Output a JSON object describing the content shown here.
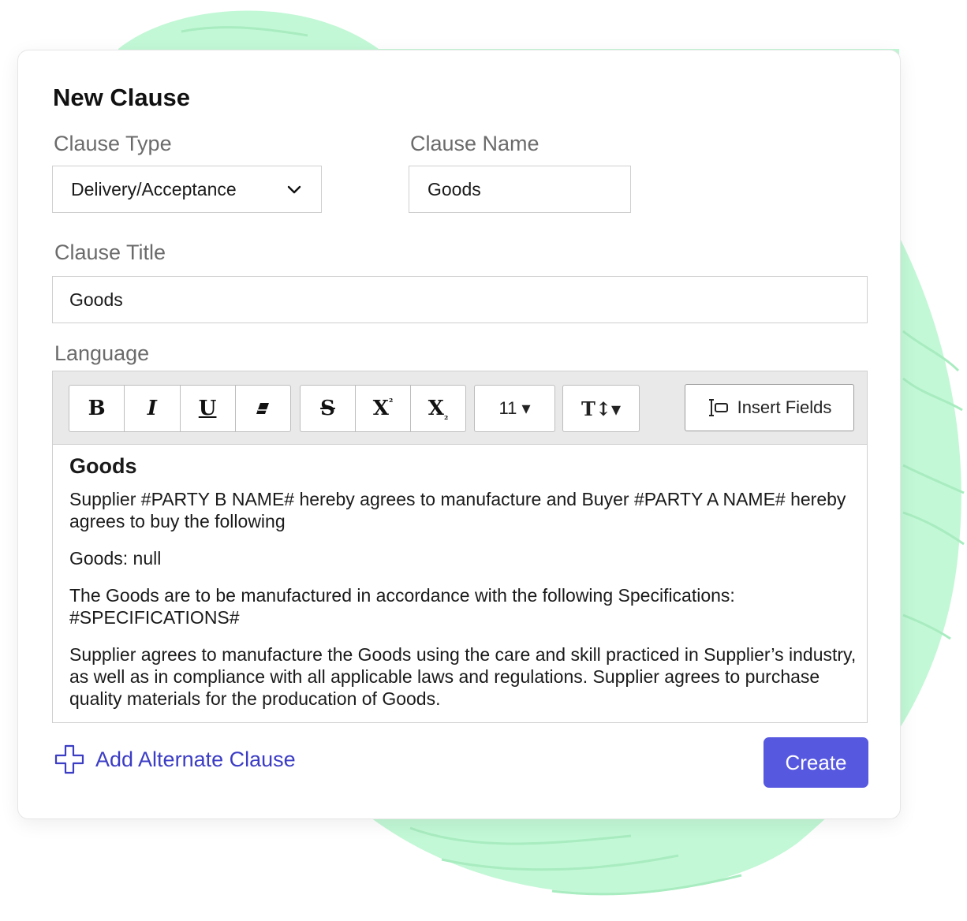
{
  "form": {
    "title": "New Clause",
    "clause_type": {
      "label": "Clause Type",
      "value": "Delivery/Acceptance"
    },
    "clause_name": {
      "label": "Clause Name",
      "value": "Goods"
    },
    "clause_title": {
      "label": "Clause Title",
      "value": "Goods"
    },
    "language_label": "Language"
  },
  "toolbar": {
    "bold": "B",
    "italic": "I",
    "underline": "U",
    "strike": "S",
    "superscript": "X",
    "superscript_mark": "²",
    "subscript": "X",
    "subscript_mark": "₂",
    "font_size": "11 ▾",
    "text_size": "T↕▾",
    "insert_fields": "Insert Fields"
  },
  "editor": {
    "heading": "Goods",
    "paragraphs": [
      "Supplier #PARTY B NAME# hereby agrees to manufacture and Buyer #PARTY A NAME# hereby agrees to buy the following",
      "Goods: null",
      "The Goods are to be manufactured in accordance with the following Specifications: #SPECIFICATIONS#",
      "Supplier agrees to manufacture the Goods using the care and skill practiced in Supplier’s industry, as well as in compliance with all applicable laws and regulations. Supplier agrees to purchase quality materials for the producation of Goods."
    ]
  },
  "actions": {
    "add_alternate": "Add Alternate Clause",
    "create": "Create"
  },
  "colors": {
    "accent": "#5758e0",
    "link": "#3c3dc5",
    "blob": "#c2f8d6"
  },
  "icons": [
    "chevron-down-icon",
    "eraser-icon",
    "insert-field-icon",
    "plus-icon"
  ]
}
